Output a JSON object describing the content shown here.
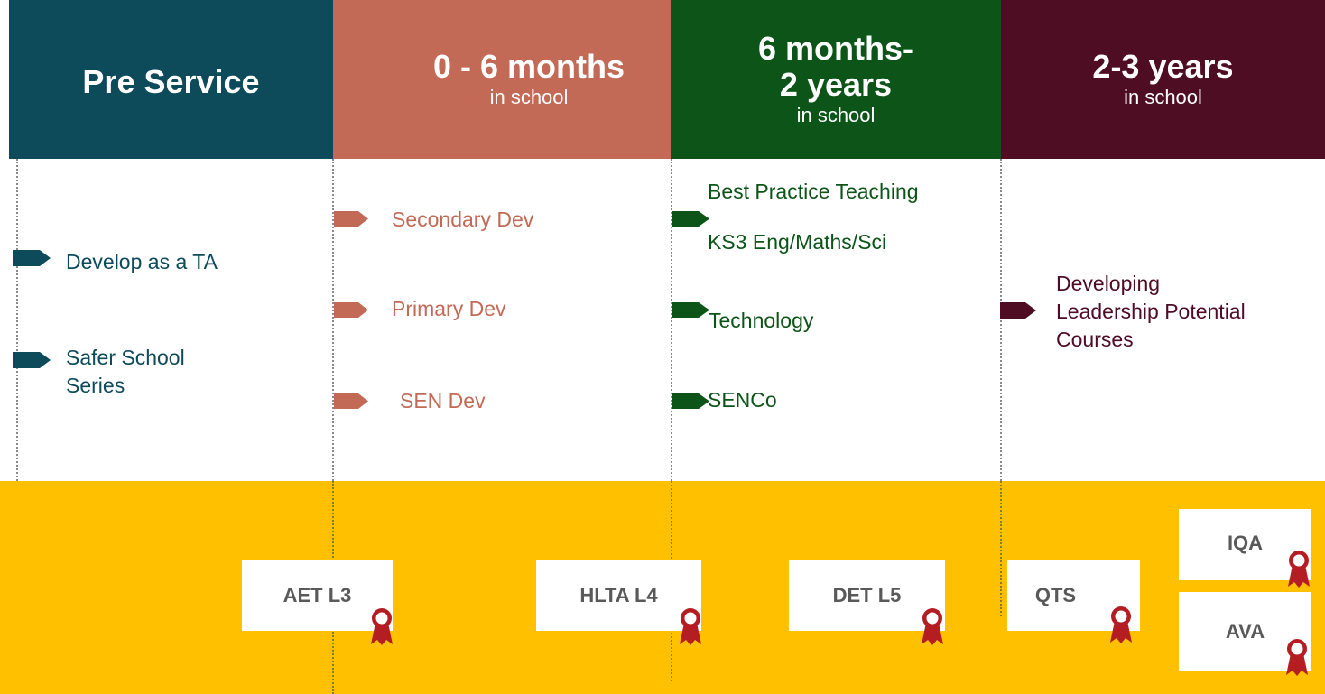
{
  "colors": {
    "pre_service": "#0D4A5A",
    "zero_six": "#C26A55",
    "six_two": "#0D5418",
    "two_three": "#4E0D22",
    "band": "#FFC000",
    "award": "#B41E22"
  },
  "columns": [
    {
      "title": "Pre Service",
      "subtitle": ""
    },
    {
      "title": "0 - 6 months",
      "subtitle": "in school"
    },
    {
      "title": "6 months-\n2 years",
      "subtitle": "in school"
    },
    {
      "title": "2-3 years",
      "subtitle": "in school"
    }
  ],
  "courses": {
    "pre_service": [
      "Develop as a TA",
      "Safer School\nSeries"
    ],
    "zero_six": [
      "Secondary Dev",
      "Primary Dev",
      "SEN Dev"
    ],
    "six_two": [
      "Best Practice Teaching",
      "KS3 Eng/Maths/Sci",
      "Technology",
      "SENCo"
    ],
    "two_three": [
      "Developing\nLeadership Potential\nCourses"
    ]
  },
  "qualifications": [
    "AET L3",
    "HLTA L4",
    "DET L5",
    "QTS",
    "IQA",
    "AVA"
  ],
  "icons": {
    "arrow": "arrow-marker-icon",
    "award": "award-ribbon-icon"
  }
}
